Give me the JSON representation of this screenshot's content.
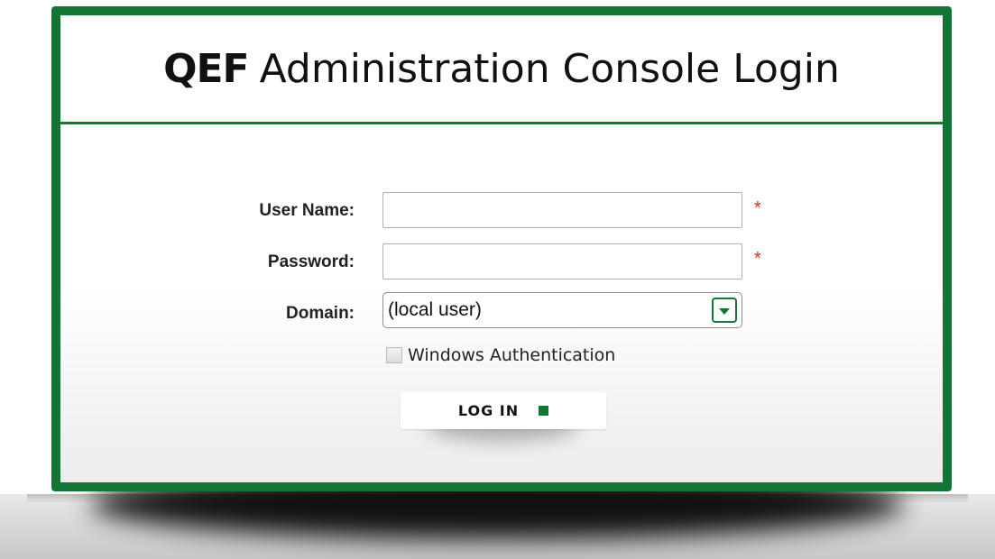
{
  "header": {
    "brand": "QEF",
    "title": "Administration Console Login"
  },
  "form": {
    "username_label": "User Name:",
    "username_value": "",
    "password_label": "Password:",
    "password_value": "",
    "domain_label": "Domain:",
    "domain_selected": "(local user)",
    "windows_auth_label": "Windows Authentication",
    "windows_auth_checked": false,
    "required_marker": "*",
    "login_label": "LOG IN"
  },
  "icons": {
    "domain_dropdown": "chevron-down-icon",
    "login_indicator": "square-icon"
  },
  "colors": {
    "accent": "#127533",
    "required": "#d92b2b"
  }
}
